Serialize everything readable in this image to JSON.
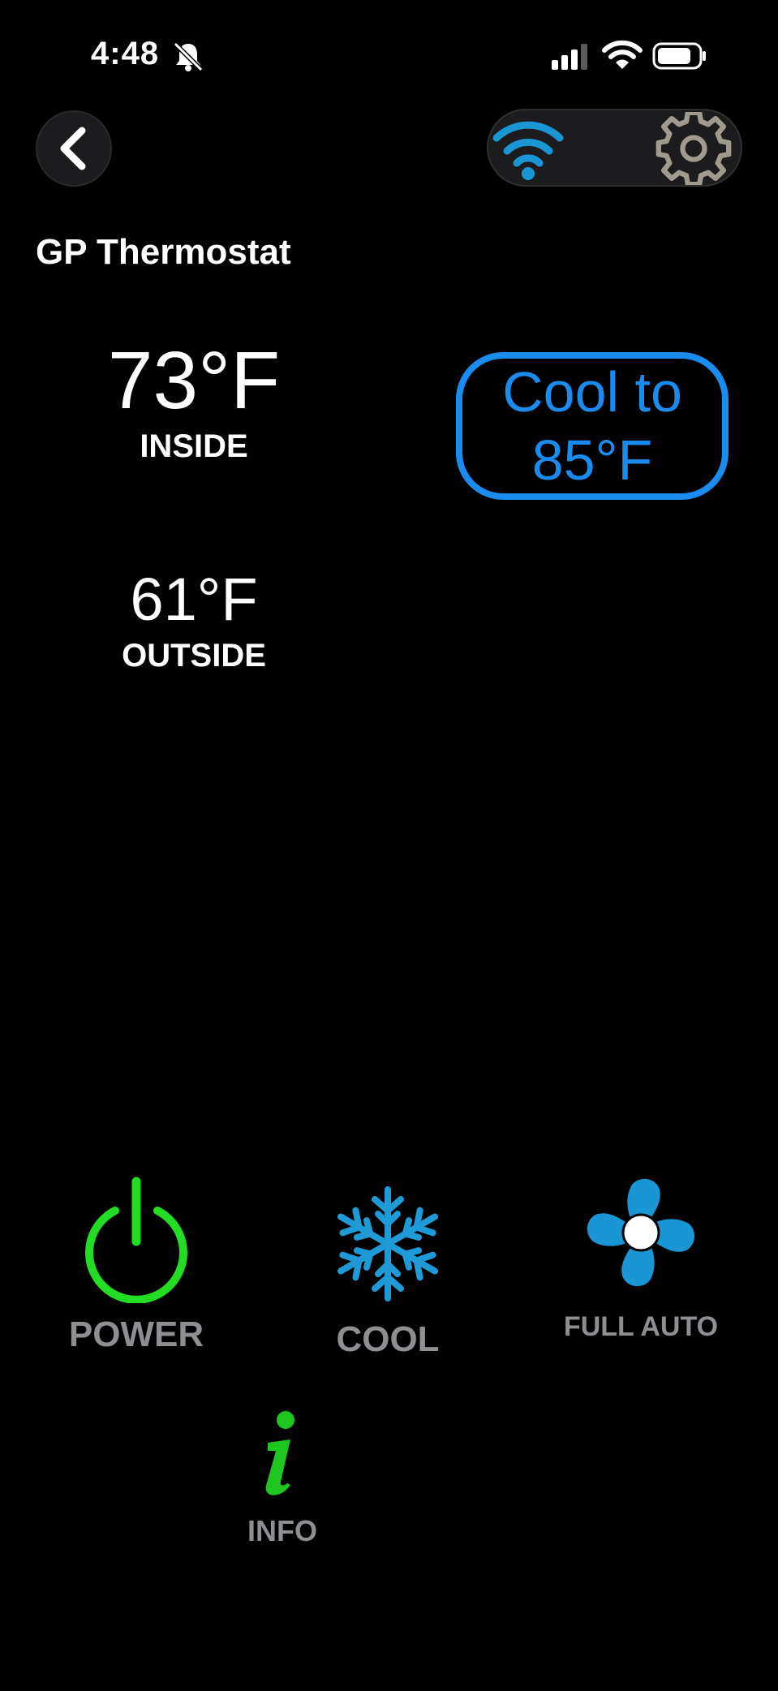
{
  "status_bar": {
    "time": "4:48",
    "icons": [
      "bell-slash-icon",
      "signal-icon",
      "wifi-icon",
      "battery-icon"
    ]
  },
  "header": {
    "back_icon": "chevron-left-icon",
    "connection_icon": "wifi-icon",
    "settings_icon": "gear-icon"
  },
  "device": {
    "title": "GP Thermostat"
  },
  "temperatures": {
    "inside_value": "73°F",
    "inside_label": "INSIDE",
    "outside_value": "61°F",
    "outside_label": "OUTSIDE"
  },
  "setpoint": {
    "line1": "Cool to",
    "line2": "85°F"
  },
  "controls": {
    "power_label": "POWER",
    "cool_label": "COOL",
    "fan_label": "FULL AUTO",
    "info_label": "INFO"
  },
  "colors": {
    "background": "#000000",
    "accent_blue": "#1a8cf0",
    "power_green": "#22dd22",
    "info_green": "#1fc61f",
    "snowflake_blue": "#1e9bd7",
    "fan_blue": "#1a96d4",
    "label_gray": "#8e8e93"
  }
}
